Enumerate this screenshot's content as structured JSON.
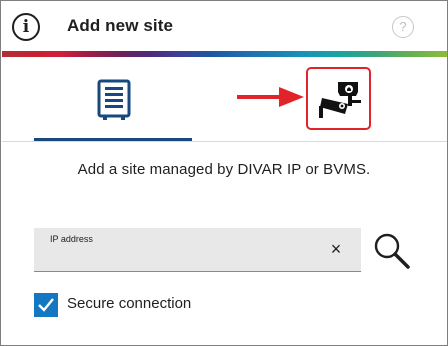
{
  "header": {
    "title": "Add new site",
    "info_icon": "info-icon",
    "info_glyph": "i",
    "help_icon": "help-icon",
    "help_glyph": "?"
  },
  "tabs": [
    {
      "name": "server",
      "icon": "server-icon",
      "selected": true
    },
    {
      "name": "camera",
      "icon": "camera-icon",
      "selected": false,
      "highlighted": true
    }
  ],
  "description": "Add a site managed by DIVAR IP or BVMS.",
  "ip_field": {
    "label": "IP address",
    "value": "",
    "clear_glyph": "×"
  },
  "secure_connection": {
    "label": "Secure connection",
    "checked": true
  },
  "colors": {
    "accent_blue": "#1477c1",
    "tab_underline": "#17497e",
    "highlight_red": "#e1242a"
  }
}
